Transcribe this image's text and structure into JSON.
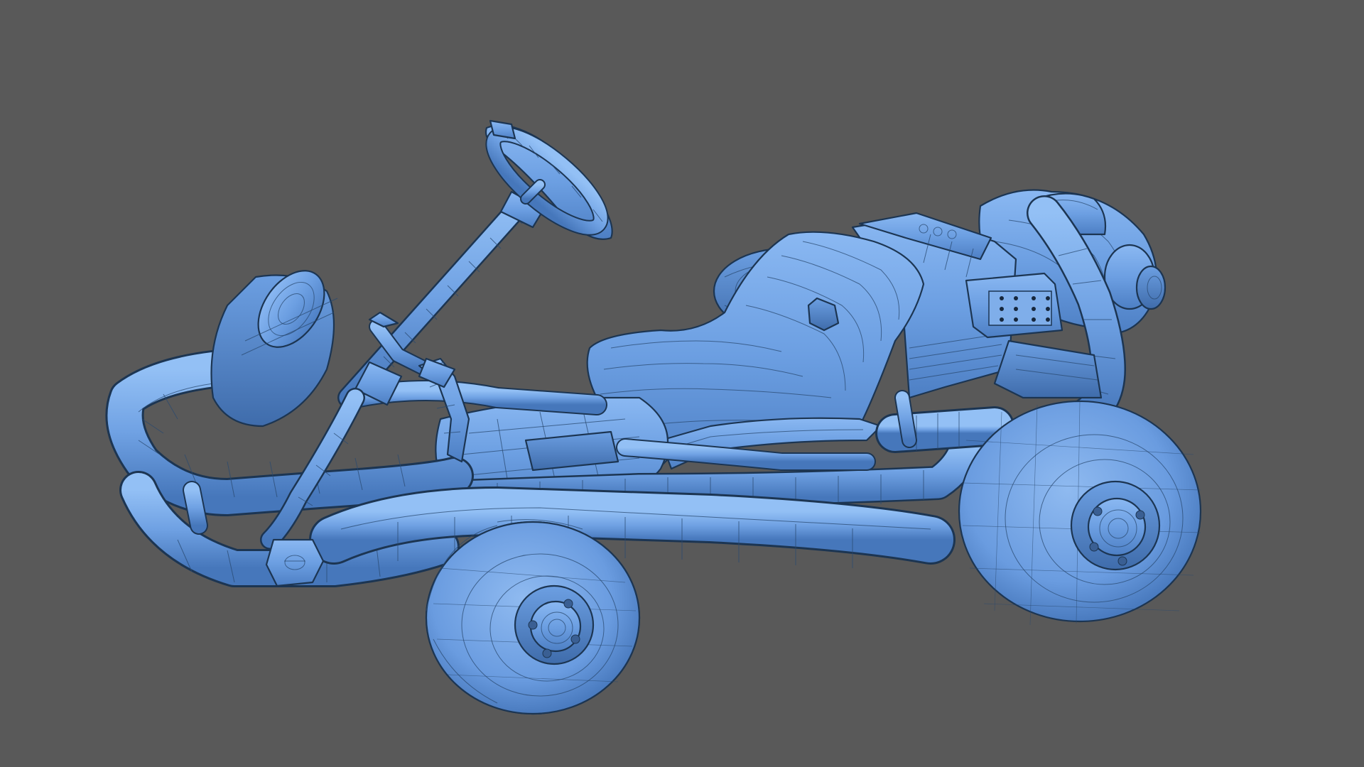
{
  "viewport": {
    "background_color": "#595959",
    "model_color": "#6b9de0",
    "wire_color": "#2a4a70",
    "display_mode": "shaded-wireframe"
  },
  "model": {
    "parts": [
      "steering-wheel",
      "steering-column",
      "seat",
      "engine",
      "exhaust-muffler",
      "front-left-wheel",
      "rear-left-wheel",
      "rear-right-wheel",
      "front-right-wheel",
      "chassis-frame",
      "front-bumper",
      "side-bumper",
      "floor-pan",
      "pedal"
    ]
  }
}
